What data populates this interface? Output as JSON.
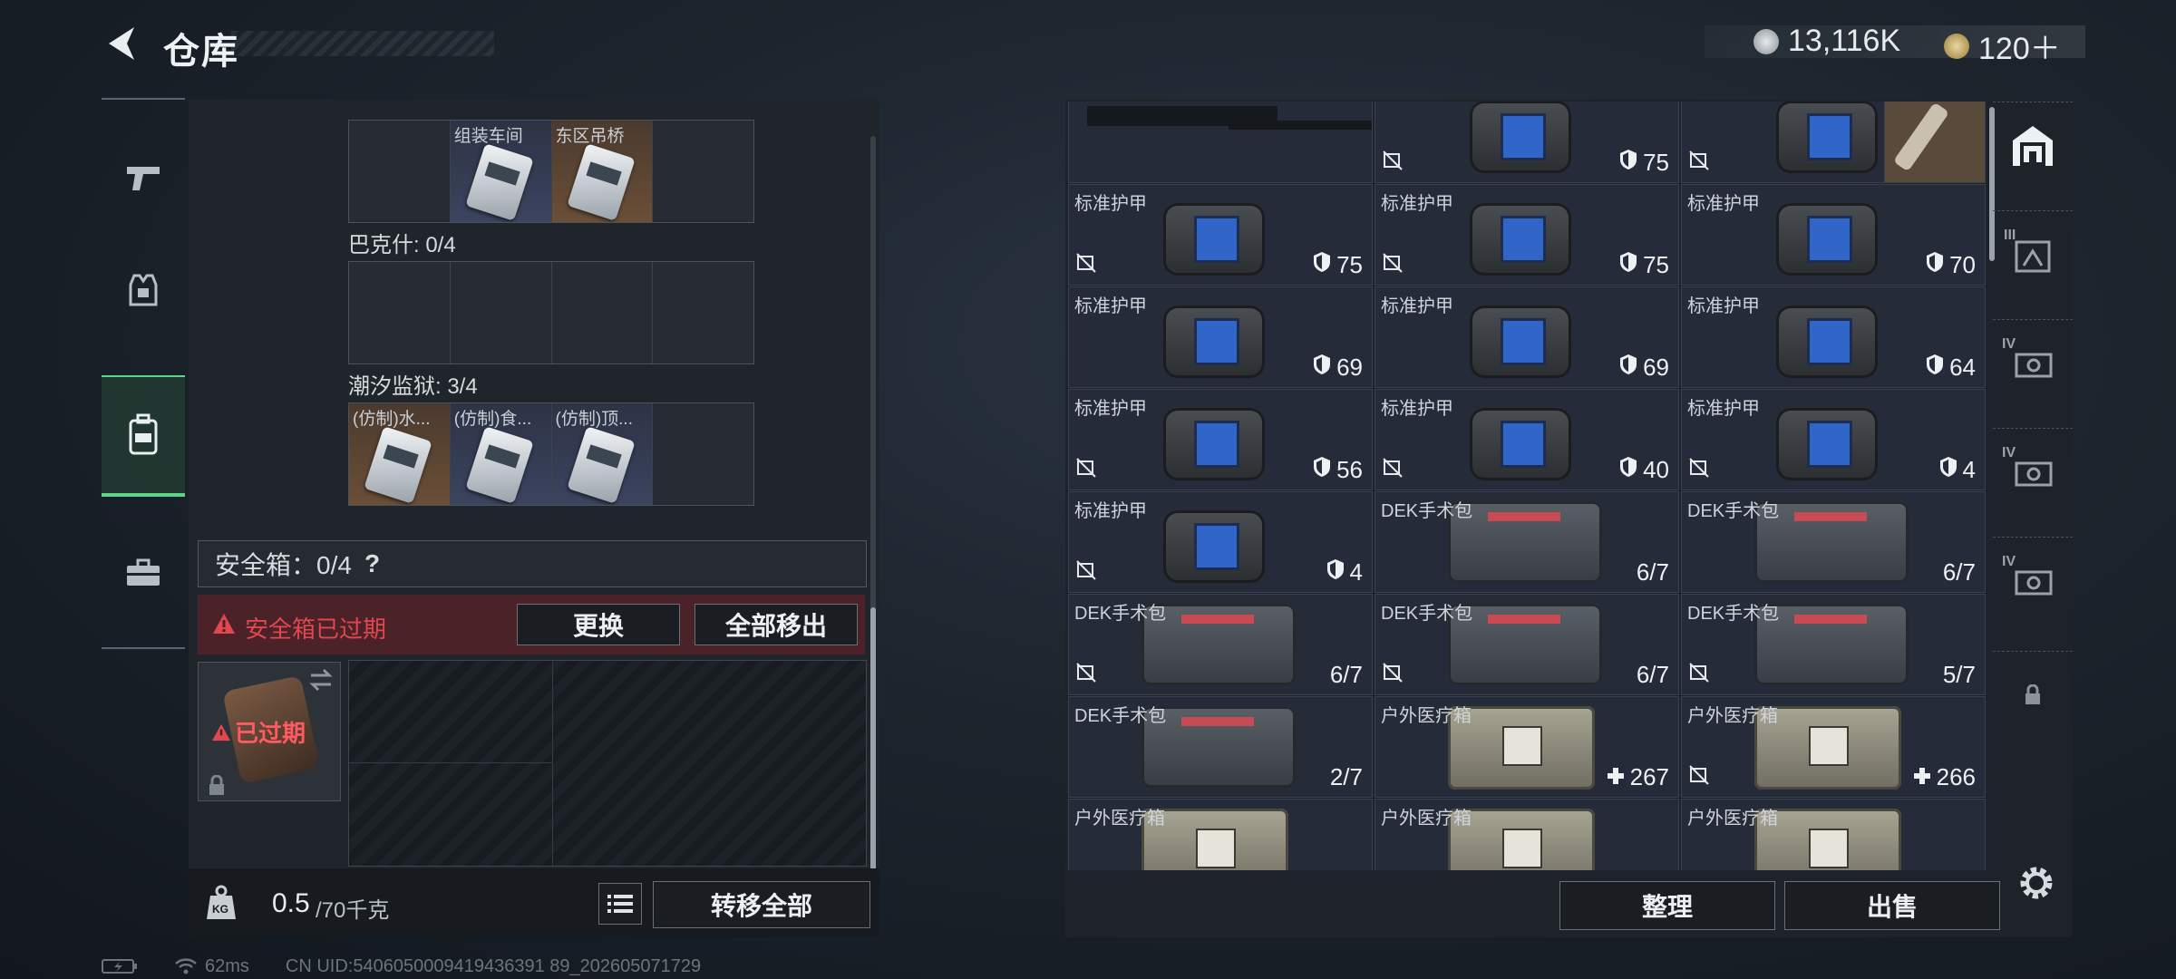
{
  "header": {
    "title": "仓库",
    "currency": [
      {
        "icon": "silver-coin-icon",
        "value": "13,116K"
      },
      {
        "icon": "gold-coin-icon",
        "value": "120＋"
      }
    ]
  },
  "left_nav": [
    {
      "icon": "pistol-icon"
    },
    {
      "icon": "armor-vest-icon"
    },
    {
      "icon": "backpack-icon",
      "active": true
    },
    {
      "icon": "briefcase-icon"
    }
  ],
  "containers": [
    {
      "label": "",
      "cells": [
        {
          "name": "",
          "style": "empty"
        },
        {
          "name": "组装车间",
          "style": "blue"
        },
        {
          "name": "东区吊桥",
          "style": "brown"
        },
        {
          "name": "",
          "style": "empty"
        }
      ]
    },
    {
      "label": "巴克什: 0/4",
      "cells": [
        {
          "name": "",
          "style": "empty"
        },
        {
          "name": "",
          "style": "empty"
        },
        {
          "name": "",
          "style": "empty"
        },
        {
          "name": "",
          "style": "empty"
        }
      ]
    },
    {
      "label": "潮汐监狱: 3/4",
      "cells": [
        {
          "name": "(仿制)水...",
          "style": "brown"
        },
        {
          "name": "(仿制)食...",
          "style": "blue"
        },
        {
          "name": "(仿制)顶...",
          "style": "blue"
        },
        {
          "name": "",
          "style": "empty"
        }
      ]
    }
  ],
  "safe_box": {
    "label": "安全箱：0/4",
    "help": "?",
    "expired_warning": "安全箱已过期",
    "replace_button": "更换",
    "move_all_out_button": "全部移出",
    "expired_badge": "已过期"
  },
  "bottom": {
    "weight_current": "0.5",
    "weight_max": "/70千克",
    "weight_icon_text": "KG",
    "transfer_all_button": "转移全部"
  },
  "inventory": [
    {
      "row": 0,
      "col": 0,
      "name": "",
      "kind": "gun",
      "value": "",
      "val_icon": "",
      "nodrop": false
    },
    {
      "row": 0,
      "col": 1,
      "name": "",
      "kind": "armor",
      "value": "75",
      "val_icon": "shield",
      "nodrop": true
    },
    {
      "row": 0,
      "col": 2,
      "name": "",
      "kind": "armor",
      "value": "75",
      "val_icon": "shield",
      "nodrop": true
    },
    {
      "row": 1,
      "col": 0,
      "name": "标准护甲",
      "kind": "armor",
      "value": "75",
      "val_icon": "shield",
      "nodrop": true
    },
    {
      "row": 1,
      "col": 1,
      "name": "标准护甲",
      "kind": "armor",
      "value": "75",
      "val_icon": "shield",
      "nodrop": true
    },
    {
      "row": 1,
      "col": 2,
      "name": "标准护甲",
      "kind": "armor",
      "value": "70",
      "val_icon": "shield",
      "nodrop": false
    },
    {
      "row": 2,
      "col": 0,
      "name": "标准护甲",
      "kind": "armor",
      "value": "69",
      "val_icon": "shield",
      "nodrop": false
    },
    {
      "row": 2,
      "col": 1,
      "name": "标准护甲",
      "kind": "armor",
      "value": "69",
      "val_icon": "shield",
      "nodrop": false
    },
    {
      "row": 2,
      "col": 2,
      "name": "标准护甲",
      "kind": "armor",
      "value": "64",
      "val_icon": "shield",
      "nodrop": false
    },
    {
      "row": 3,
      "col": 0,
      "name": "标准护甲",
      "kind": "armor",
      "value": "56",
      "val_icon": "shield",
      "nodrop": true
    },
    {
      "row": 3,
      "col": 1,
      "name": "标准护甲",
      "kind": "armor",
      "value": "40",
      "val_icon": "shield",
      "nodrop": true
    },
    {
      "row": 3,
      "col": 2,
      "name": "标准护甲",
      "kind": "armor",
      "value": "4",
      "val_icon": "shield",
      "nodrop": true
    },
    {
      "row": 4,
      "col": 0,
      "name": "标准护甲",
      "kind": "armor",
      "value": "4",
      "val_icon": "shield",
      "nodrop": true
    },
    {
      "row": 4,
      "col": 1,
      "name": "DEK手术包",
      "kind": "medkit",
      "value": "6/7",
      "val_icon": "",
      "nodrop": false
    },
    {
      "row": 4,
      "col": 2,
      "name": "DEK手术包",
      "kind": "medkit",
      "value": "6/7",
      "val_icon": "",
      "nodrop": false
    },
    {
      "row": 5,
      "col": 0,
      "name": "DEK手术包",
      "kind": "medkit",
      "value": "6/7",
      "val_icon": "",
      "nodrop": true
    },
    {
      "row": 5,
      "col": 1,
      "name": "DEK手术包",
      "kind": "medkit",
      "value": "6/7",
      "val_icon": "",
      "nodrop": true
    },
    {
      "row": 5,
      "col": 2,
      "name": "DEK手术包",
      "kind": "medkit",
      "value": "5/7",
      "val_icon": "",
      "nodrop": true
    },
    {
      "row": 6,
      "col": 0,
      "name": "DEK手术包",
      "kind": "medkit",
      "value": "2/7",
      "val_icon": "",
      "nodrop": false
    },
    {
      "row": 6,
      "col": 1,
      "name": "户外医疗箱",
      "kind": "medbox",
      "value": "267",
      "val_icon": "plus",
      "nodrop": false
    },
    {
      "row": 6,
      "col": 2,
      "name": "户外医疗箱",
      "kind": "medbox",
      "value": "266",
      "val_icon": "plus",
      "nodrop": true
    },
    {
      "row": 7,
      "col": 0,
      "name": "户外医疗箱",
      "kind": "medbox",
      "value": "",
      "val_icon": "",
      "nodrop": false
    },
    {
      "row": 7,
      "col": 1,
      "name": "户外医疗箱",
      "kind": "medbox",
      "value": "",
      "val_icon": "",
      "nodrop": false
    },
    {
      "row": 7,
      "col": 2,
      "name": "户外医疗箱",
      "kind": "medbox",
      "value": "",
      "val_icon": "",
      "nodrop": false
    }
  ],
  "actions": {
    "organize": "整理",
    "sell": "出售"
  },
  "right_sidebar": [
    {
      "icon": "stash-icon",
      "label": ""
    },
    {
      "icon": "tier-3-case-icon",
      "label": "III"
    },
    {
      "icon": "tier-4-case-icon",
      "label": "IV"
    },
    {
      "icon": "tier-4-case-icon",
      "label": "IV"
    },
    {
      "icon": "tier-4-case-icon",
      "label": "IV"
    },
    {
      "icon": "lock-icon",
      "label": ""
    }
  ],
  "status": {
    "ping": "62ms",
    "uid": "CN UID:5406050009419436391 89_202605071729"
  },
  "colors": {
    "accent_green": "#5ed48b",
    "warning_red": "#e0474f"
  }
}
